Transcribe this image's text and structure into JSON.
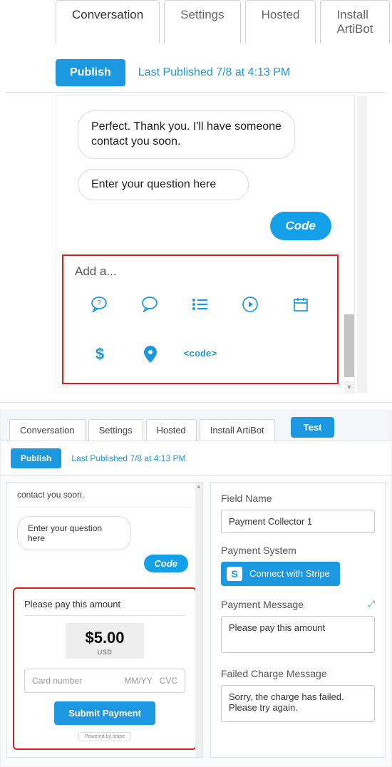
{
  "top": {
    "tabs": [
      "Conversation",
      "Settings",
      "Hosted",
      "Install ArtiBot"
    ],
    "publish_btn": "Publish",
    "last_published": "Last Published 7/8 at 4:13 PM",
    "bot_message": "Perfect. Thank you. I'll have someone contact you soon.",
    "question_bubble": "Enter your question here",
    "code_pill": "Code",
    "add_box": {
      "title": "Add a...",
      "code_label": "<code>"
    }
  },
  "bottom": {
    "tabs": [
      "Conversation",
      "Settings",
      "Hosted",
      "Install ArtiBot"
    ],
    "test_btn": "Test",
    "publish_btn": "Publish",
    "last_published": "Last Published 7/8 at 4:13 PM",
    "left": {
      "trailing_msg": "contact you soon.",
      "question_bubble": "Enter your question here",
      "code_pill": "Code",
      "pay_title": "Please pay this amount",
      "amount": "$5.00",
      "currency": "USD",
      "card_placeholder": "Card number",
      "card_mm": "MM/YY",
      "card_cvc": "CVC",
      "submit": "Submit Payment",
      "stripe_badge": "Powered by stripe"
    },
    "right": {
      "field_name_label": "Field Name",
      "field_name_value": "Payment Collector 1",
      "payment_system_label": "Payment System",
      "stripe_btn": "Connect with Stripe",
      "payment_message_label": "Payment Message",
      "payment_message_value": "Please pay this amount",
      "failed_label": "Failed Charge Message",
      "failed_value": "Sorry, the charge has failed. Please try again."
    }
  }
}
